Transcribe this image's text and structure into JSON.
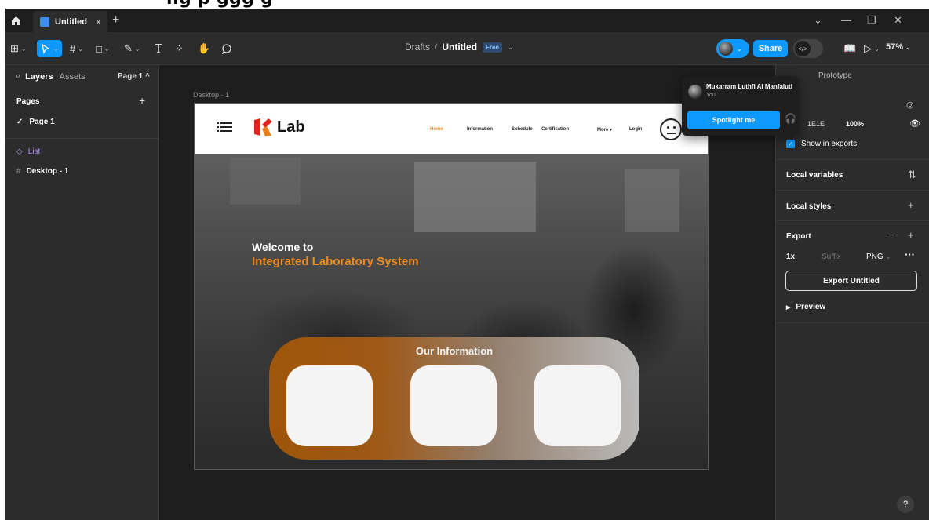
{
  "caption": "ng p               ggg    g",
  "titlebar": {
    "tab_label": "Untitled",
    "tab_close": "×",
    "new_tab": "+",
    "win_min": "—",
    "win_restore": "❐",
    "win_close": "✕",
    "win_chevron": "⌄"
  },
  "toolbar": {
    "breadcrumb_parent": "Drafts",
    "breadcrumb_sep": "/",
    "file_name": "Untitled",
    "plan_badge": "Free",
    "share_label": "Share",
    "zoom_label": "57%"
  },
  "left_panel": {
    "tab_layers": "Layers",
    "tab_assets": "Assets",
    "page_selector": "Page 1 ^",
    "pages_heading": "Pages",
    "page_item": "Page 1",
    "layers": [
      {
        "name": "List",
        "icon": "component-icon"
      },
      {
        "name": "Desktop - 1",
        "icon": "frame-icon"
      }
    ]
  },
  "canvas": {
    "frame_label": "Desktop - 1",
    "site": {
      "logo_text": "Lab",
      "nav_links": [
        "Home",
        "Information",
        "Schedule",
        "Certification",
        "More",
        "Login"
      ],
      "active_link": "Home",
      "welcome_line1": "Welcome to",
      "welcome_line2": "Integrated Laboratory System",
      "info_title": "Our Information",
      "accent_color": "#f28c1b"
    }
  },
  "popover": {
    "user_name": "Mukarram Luthfi Al Manfaluti",
    "user_sub": "You",
    "spotlight_label": "Spotlight me"
  },
  "right_panel": {
    "tab_prototype": "Prototype",
    "fill_hex": "1E1E",
    "fill_opacity": "100%",
    "show_in_exports": "Show in exports",
    "local_variables": "Local variables",
    "local_styles": "Local styles",
    "export_heading": "Export",
    "export_scale": "1x",
    "export_suffix": "Suffix",
    "export_format": "PNG",
    "export_button": "Export Untitled",
    "preview_label": "Preview",
    "help": "?"
  },
  "colors": {
    "accent_blue": "#0d99ff",
    "canvas_bg": "#1e1e1e",
    "panel_bg": "#2c2c2c"
  }
}
